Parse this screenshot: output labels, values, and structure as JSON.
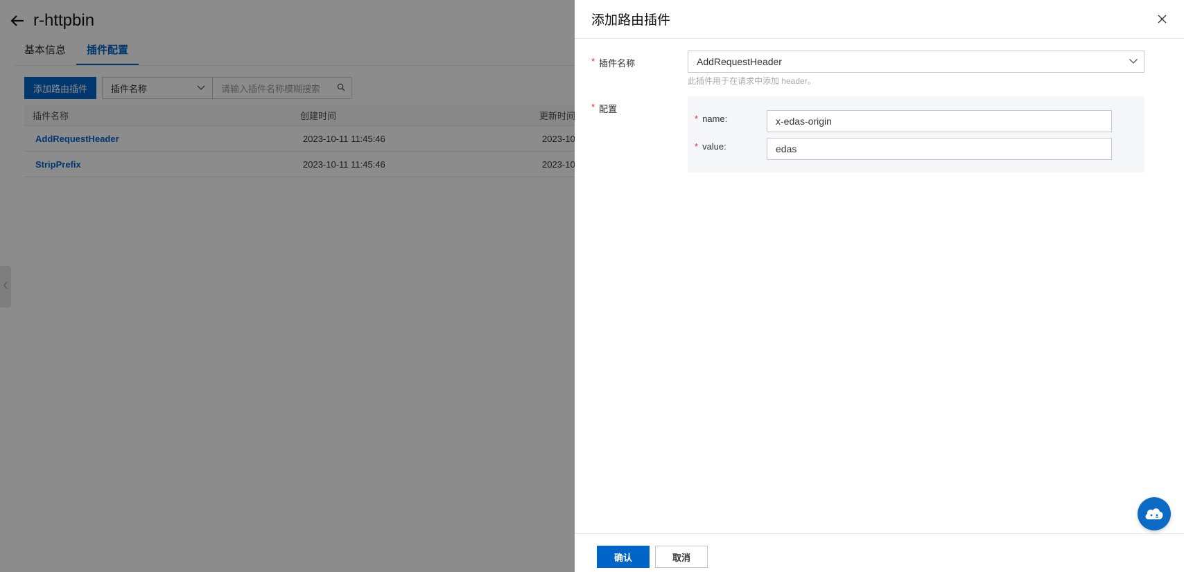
{
  "page": {
    "title": "r-httpbin",
    "tabs": [
      {
        "label": "基本信息",
        "active": false
      },
      {
        "label": "插件配置",
        "active": true
      }
    ],
    "toolbar": {
      "add_button_label": "添加路由插件",
      "filter_select_value": "插件名称",
      "search_placeholder": "请输入插件名称模糊搜索"
    },
    "table": {
      "columns": [
        "插件名称",
        "创建时间",
        "更新时间"
      ],
      "rows": [
        {
          "name": "AddRequestHeader",
          "created": "2023-10-11 11:45:46",
          "updated": "2023-10"
        },
        {
          "name": "StripPrefix",
          "created": "2023-10-11 11:45:46",
          "updated": "2023-10"
        }
      ]
    }
  },
  "drawer": {
    "title": "添加路由插件",
    "plugin_name_label": "插件名称",
    "plugin_select_value": "AddRequestHeader",
    "plugin_help": "此插件用于在请求中添加 header。",
    "config_label": "配置",
    "config_fields": [
      {
        "label": "name:",
        "value": "x-edas-origin"
      },
      {
        "label": "value:",
        "value": "edas"
      }
    ],
    "confirm_label": "确认",
    "cancel_label": "取消"
  },
  "colors": {
    "primary": "#0064c8",
    "required": "#d93026",
    "mask": "rgba(0,0,0,0.45)"
  },
  "icons": [
    "back-arrow-icon",
    "chevron-down-icon",
    "search-icon",
    "close-icon",
    "chevron-left-icon",
    "cloud-assistant-icon"
  ]
}
